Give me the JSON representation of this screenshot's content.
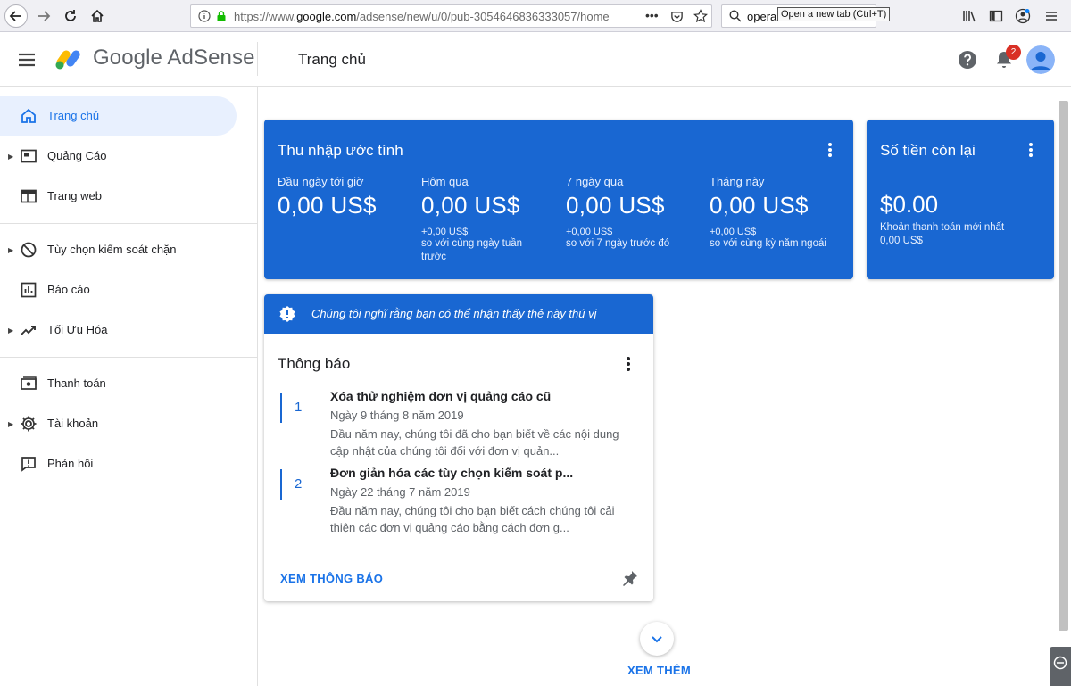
{
  "browser": {
    "url_prefix": "https://www.",
    "url_host": "google.com",
    "url_path": "/adsense/new/u/0/pub-3054646836333057/home",
    "search_value": "opera",
    "tooltip": "Open a new tab (Ctrl+T)"
  },
  "header": {
    "logo_text": "Google AdSense",
    "page_title": "Trang chủ",
    "notification_count": "2"
  },
  "sidebar": {
    "items": [
      {
        "label": "Trang chủ",
        "icon": "home-icon"
      },
      {
        "label": "Quảng Cáo",
        "icon": "ads-icon"
      },
      {
        "label": "Trang web",
        "icon": "sites-icon"
      },
      {
        "label": "Tùy chọn kiểm soát chặn",
        "icon": "block-icon"
      },
      {
        "label": "Báo cáo",
        "icon": "reports-icon"
      },
      {
        "label": "Tối Ưu Hóa",
        "icon": "trending-icon"
      },
      {
        "label": "Thanh toán",
        "icon": "payments-icon"
      },
      {
        "label": "Tài khoản",
        "icon": "settings-icon"
      },
      {
        "label": "Phản hồi",
        "icon": "feedback-icon"
      }
    ]
  },
  "earnings": {
    "title": "Thu nhập ước tính",
    "metrics": [
      {
        "label": "Đầu ngày tới giờ",
        "value": "0,00 US$",
        "delta": "",
        "compare": ""
      },
      {
        "label": "Hôm qua",
        "value": "0,00 US$",
        "delta": "+0,00 US$",
        "compare": "so với cùng ngày tuần trước"
      },
      {
        "label": "7 ngày qua",
        "value": "0,00 US$",
        "delta": "+0,00 US$",
        "compare": "so với 7 ngày trước đó"
      },
      {
        "label": "Tháng này",
        "value": "0,00 US$",
        "delta": "+0,00 US$",
        "compare": "so với cùng kỳ năm ngoái"
      }
    ]
  },
  "balance": {
    "title": "Số tiền còn lại",
    "value": "$0.00",
    "last_payment_label": "Khoản thanh toán mới nhất",
    "last_payment_value": "0,00 US$"
  },
  "notices": {
    "banner": "Chúng tôi nghĩ rằng bạn có thể nhận thấy thẻ này thú vị",
    "title": "Thông báo",
    "items": [
      {
        "number": "1",
        "title": "Xóa thử nghiệm đơn vị quảng cáo cũ",
        "date": "Ngày 9 tháng 8 năm 2019",
        "description": "Đầu năm nay, chúng tôi đã cho bạn biết về các nội dung cập nhật của chúng tôi đối với đơn vị quản..."
      },
      {
        "number": "2",
        "title": "Đơn giản hóa các tùy chọn kiểm soát p...",
        "date": "Ngày 22 tháng 7 năm 2019",
        "description": "Đầu năm nay, chúng tôi cho bạn biết cách chúng tôi cải thiện các đơn vị quảng cáo bằng cách đơn g..."
      }
    ],
    "view_all": "XEM THÔNG BÁO"
  },
  "more": {
    "label": "XEM THÊM"
  },
  "colors": {
    "brand_blue": "#1967d2",
    "link_blue": "#1a73e8",
    "active_nav_bg": "#e8f0fe",
    "badge_red": "#d93025"
  }
}
